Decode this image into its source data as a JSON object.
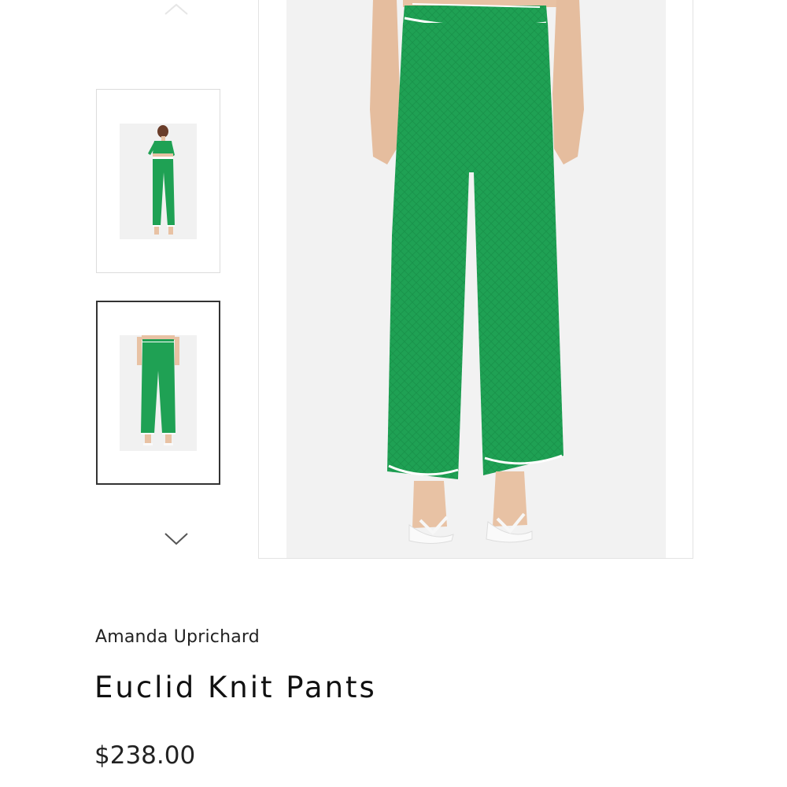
{
  "gallery": {
    "up_icon": "chevron-up-icon",
    "down_icon": "chevron-down-icon",
    "thumbnails": [
      {
        "id": "full-outfit",
        "selected": false
      },
      {
        "id": "pants-front",
        "selected": true
      }
    ],
    "accent_color": "#1fa154",
    "trim_color": "#ffffff",
    "skin_color": "#e8c2a4"
  },
  "product": {
    "brand": "Amanda Uprichard",
    "name": "Euclid Knit Pants",
    "price": "$238.00"
  }
}
